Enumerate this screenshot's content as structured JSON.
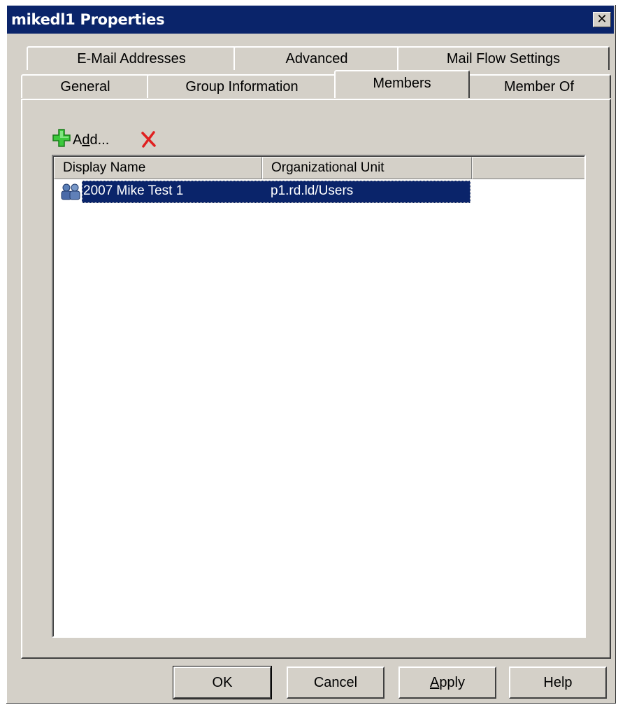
{
  "window": {
    "title": "mikedl1 Properties",
    "close_glyph": "✕"
  },
  "tabs_row1": [
    {
      "label": "E-Mail Addresses"
    },
    {
      "label": "Advanced"
    },
    {
      "label": "Mail Flow Settings"
    }
  ],
  "tabs_row2": [
    {
      "label": "General"
    },
    {
      "label": "Group Information"
    },
    {
      "label": "Members",
      "active": true
    },
    {
      "label": "Member Of"
    }
  ],
  "toolbar": {
    "add_prefix": "A",
    "add_underlined": "d",
    "add_suffix": "d...",
    "add_icon": "green-plus-icon",
    "remove_icon": "red-x-icon"
  },
  "members_list": {
    "columns": [
      "Display Name",
      "Organizational Unit"
    ],
    "rows": [
      {
        "display_name": "2007 Mike Test 1",
        "organizational_unit": "p1.rd.ld/Users",
        "icon": "user-group-icon",
        "selected": true
      }
    ]
  },
  "buttons": {
    "ok": "OK",
    "cancel": "Cancel",
    "apply_underlined": "A",
    "apply_rest": "pply",
    "help": "Help"
  },
  "colors": {
    "titlebar": "#0a246a",
    "face": "#d4d0c8",
    "selection": "#0a246a"
  }
}
